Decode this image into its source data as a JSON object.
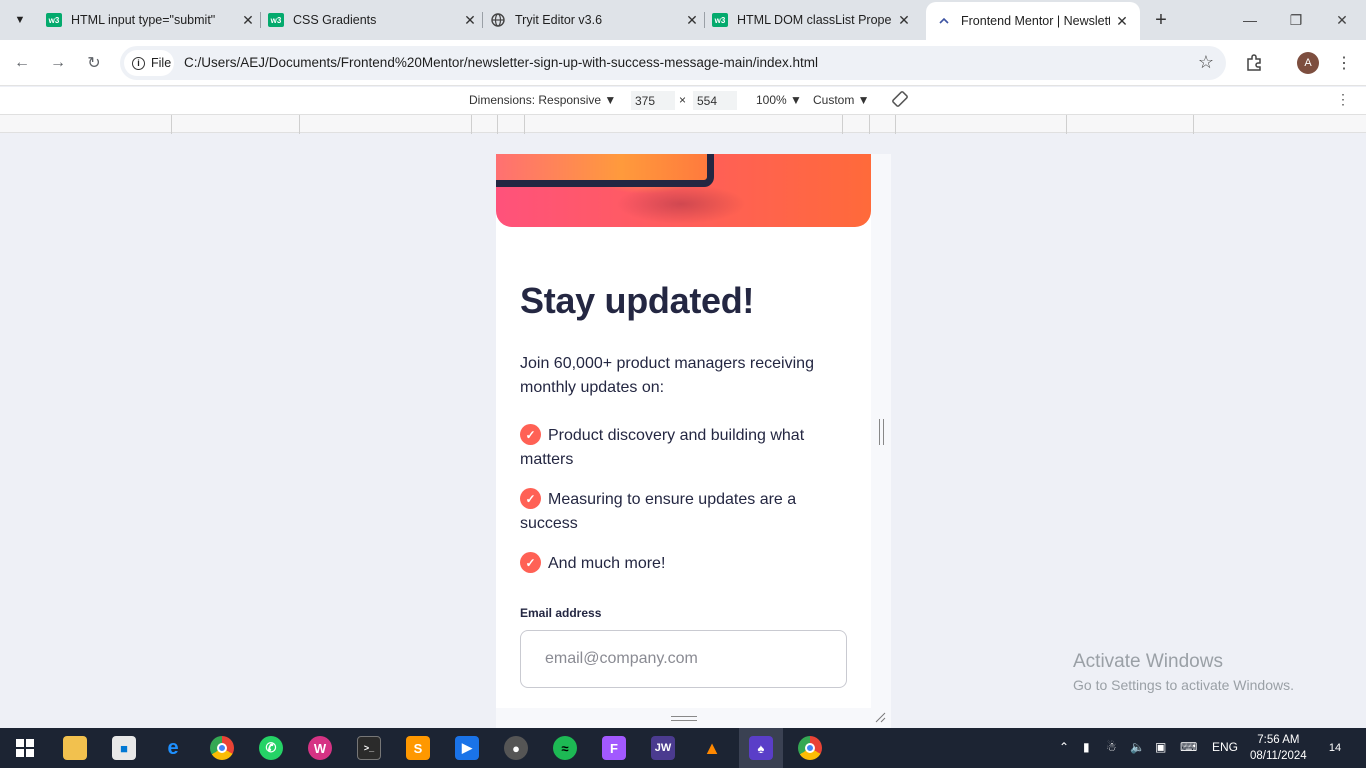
{
  "browser": {
    "tabs": [
      {
        "title": "HTML input type=\"submit\"",
        "favicon": "w3schools-icon"
      },
      {
        "title": "CSS Gradients",
        "favicon": "w3schools-icon"
      },
      {
        "title": "Tryit Editor v3.6",
        "favicon": "globe-icon"
      },
      {
        "title": "HTML DOM classList Propert",
        "favicon": "w3schools-icon"
      },
      {
        "title": "Frontend Mentor | Newslette",
        "favicon": "frontend-mentor-icon",
        "active": true
      }
    ],
    "file_chip": "File",
    "url": "C:/Users/AEJ/Documents/Frontend%20Mentor/newsletter-sign-up-with-success-message-main/index.html",
    "profile_initial": "A"
  },
  "devtools": {
    "dimensions_label": "Dimensions: Responsive",
    "width": "375",
    "times": "×",
    "height": "554",
    "zoom": "100%",
    "throttle": "Custom"
  },
  "page": {
    "heading": "Stay updated!",
    "lede": "Join 60,000+ product managers receiving monthly updates on:",
    "benefits": [
      "Product discovery and building what matters",
      "Measuring to ensure updates are a success",
      "And much more!"
    ],
    "email_label": "Email address",
    "email_placeholder": "email@company.com",
    "accent_color": "#ff6155",
    "dark_color": "#242742"
  },
  "watermark": {
    "line1": "Activate Windows",
    "line2": "Go to Settings to activate Windows."
  },
  "taskbar": {
    "language": "ENG",
    "time": "7:56 AM",
    "date": "08/11/2024",
    "notifications": "14"
  }
}
